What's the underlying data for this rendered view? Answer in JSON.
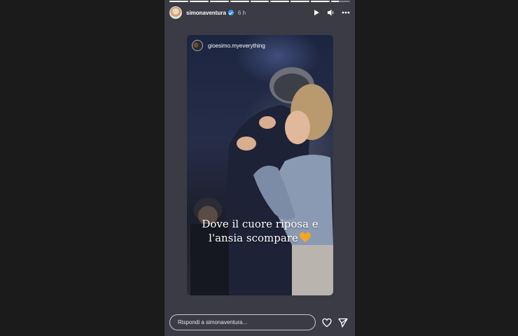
{
  "story": {
    "progress": [
      1,
      1,
      1,
      1,
      1,
      1,
      1,
      1,
      0.4
    ],
    "username": "simonaventura",
    "time_ago": "6 h",
    "card": {
      "username": "gioesimo.myeverything",
      "caption_line1": "Dove il cuore riposa e",
      "caption_line2": "l'ansia scompare"
    },
    "reply_placeholder": "Rispondi a simonaventura..."
  },
  "icons": [
    "verified-icon",
    "play-icon",
    "volume-icon",
    "more-icon",
    "heart-icon",
    "send-icon",
    "orange-heart-emoji"
  ],
  "colors": {
    "panel": "#3a3b45",
    "background": "#1b1b1b",
    "verified": "#3897f0",
    "heart_emoji": "#f5a623"
  }
}
